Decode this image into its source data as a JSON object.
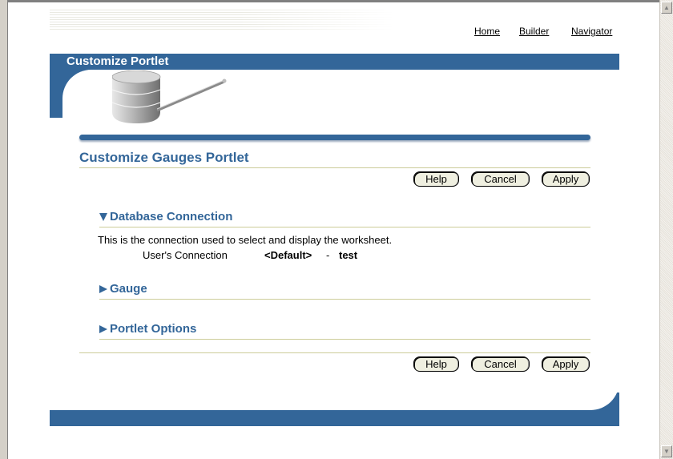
{
  "nav": {
    "home": "Home",
    "builder": "Builder",
    "navigator": "Navigator"
  },
  "banner": {
    "title": "Customize Portlet"
  },
  "page": {
    "heading": "Customize Gauges Portlet"
  },
  "buttons": {
    "help": "Help",
    "cancel": "Cancel",
    "apply": "Apply"
  },
  "sections": {
    "database": {
      "title": "Database Connection",
      "description": "This is the connection used to select and display the worksheet.",
      "connection_label": "User's Connection",
      "connection_default": "<Default>",
      "connection_sep": "-",
      "connection_name": "test"
    },
    "gauge": {
      "title": "Gauge"
    },
    "options": {
      "title": "Portlet Options"
    }
  },
  "colors": {
    "accent": "#336699",
    "rule": "#cccc99",
    "button_bg": "#efefe0"
  }
}
